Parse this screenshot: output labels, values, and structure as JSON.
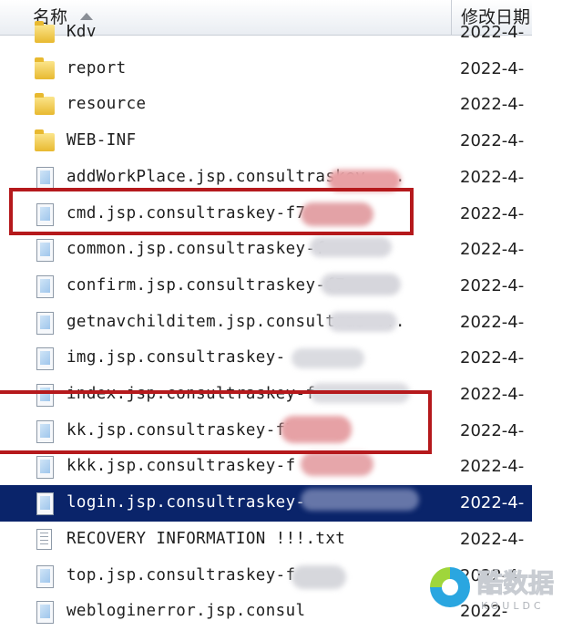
{
  "header": {
    "name_col": "名称",
    "date_col": "修改日期"
  },
  "files": [
    {
      "name": "Kdv",
      "date": "2022-4-",
      "icon": "folder-icon"
    },
    {
      "name": "report",
      "date": "2022-4-",
      "icon": "folder-icon"
    },
    {
      "name": "resource",
      "date": "2022-4-",
      "icon": "folder-icon"
    },
    {
      "name": "WEB-INF",
      "date": "2022-4-",
      "icon": "folder-icon"
    },
    {
      "name": "addWorkPlace.jsp.consultraskey-...",
      "date": "2022-4-",
      "icon": "file-icon"
    },
    {
      "name": "cmd.jsp.consultraskey-f7",
      "date": "2022-4-",
      "icon": "file-icon"
    },
    {
      "name": "common.jsp.consultraskey-f",
      "date": "2022-4-",
      "icon": "file-icon"
    },
    {
      "name": "confirm.jsp.consultraskey-f7",
      "date": "2022-4-",
      "icon": "file-icon"
    },
    {
      "name": "getnavchilditem.jsp.consultras ...",
      "date": "2022-4-",
      "icon": "file-icon"
    },
    {
      "name": "img.jsp.consultraskey-",
      "date": "2022-4-",
      "icon": "file-icon"
    },
    {
      "name": "index.jsp.consultraskey-f",
      "date": "2022-4-",
      "icon": "file-icon"
    },
    {
      "name": "kk.jsp.consultraskey-f7",
      "date": "2022-4-",
      "icon": "file-icon"
    },
    {
      "name": "kkk.jsp.consultraskey-f",
      "date": "2022-4-",
      "icon": "file-icon"
    },
    {
      "name": "login.jsp.consultraskey-",
      "date": "2022-4-",
      "icon": "file-icon"
    },
    {
      "name": "RECOVERY INFORMATION !!!.txt",
      "date": "2022-4-",
      "icon": "txt-file-icon"
    },
    {
      "name": "top.jsp.consultraskey-f",
      "date": "2022-4-",
      "icon": "file-icon"
    },
    {
      "name": "webloginerror.jsp.consul",
      "date": "2022-",
      "icon": "file-icon"
    }
  ],
  "selected_index": 13,
  "colors": {
    "selection": "#0a246a",
    "annotation": "#b5191c",
    "folder": "#e8b930"
  },
  "watermark": {
    "text": "酷数据",
    "sub": "KOULDC"
  }
}
